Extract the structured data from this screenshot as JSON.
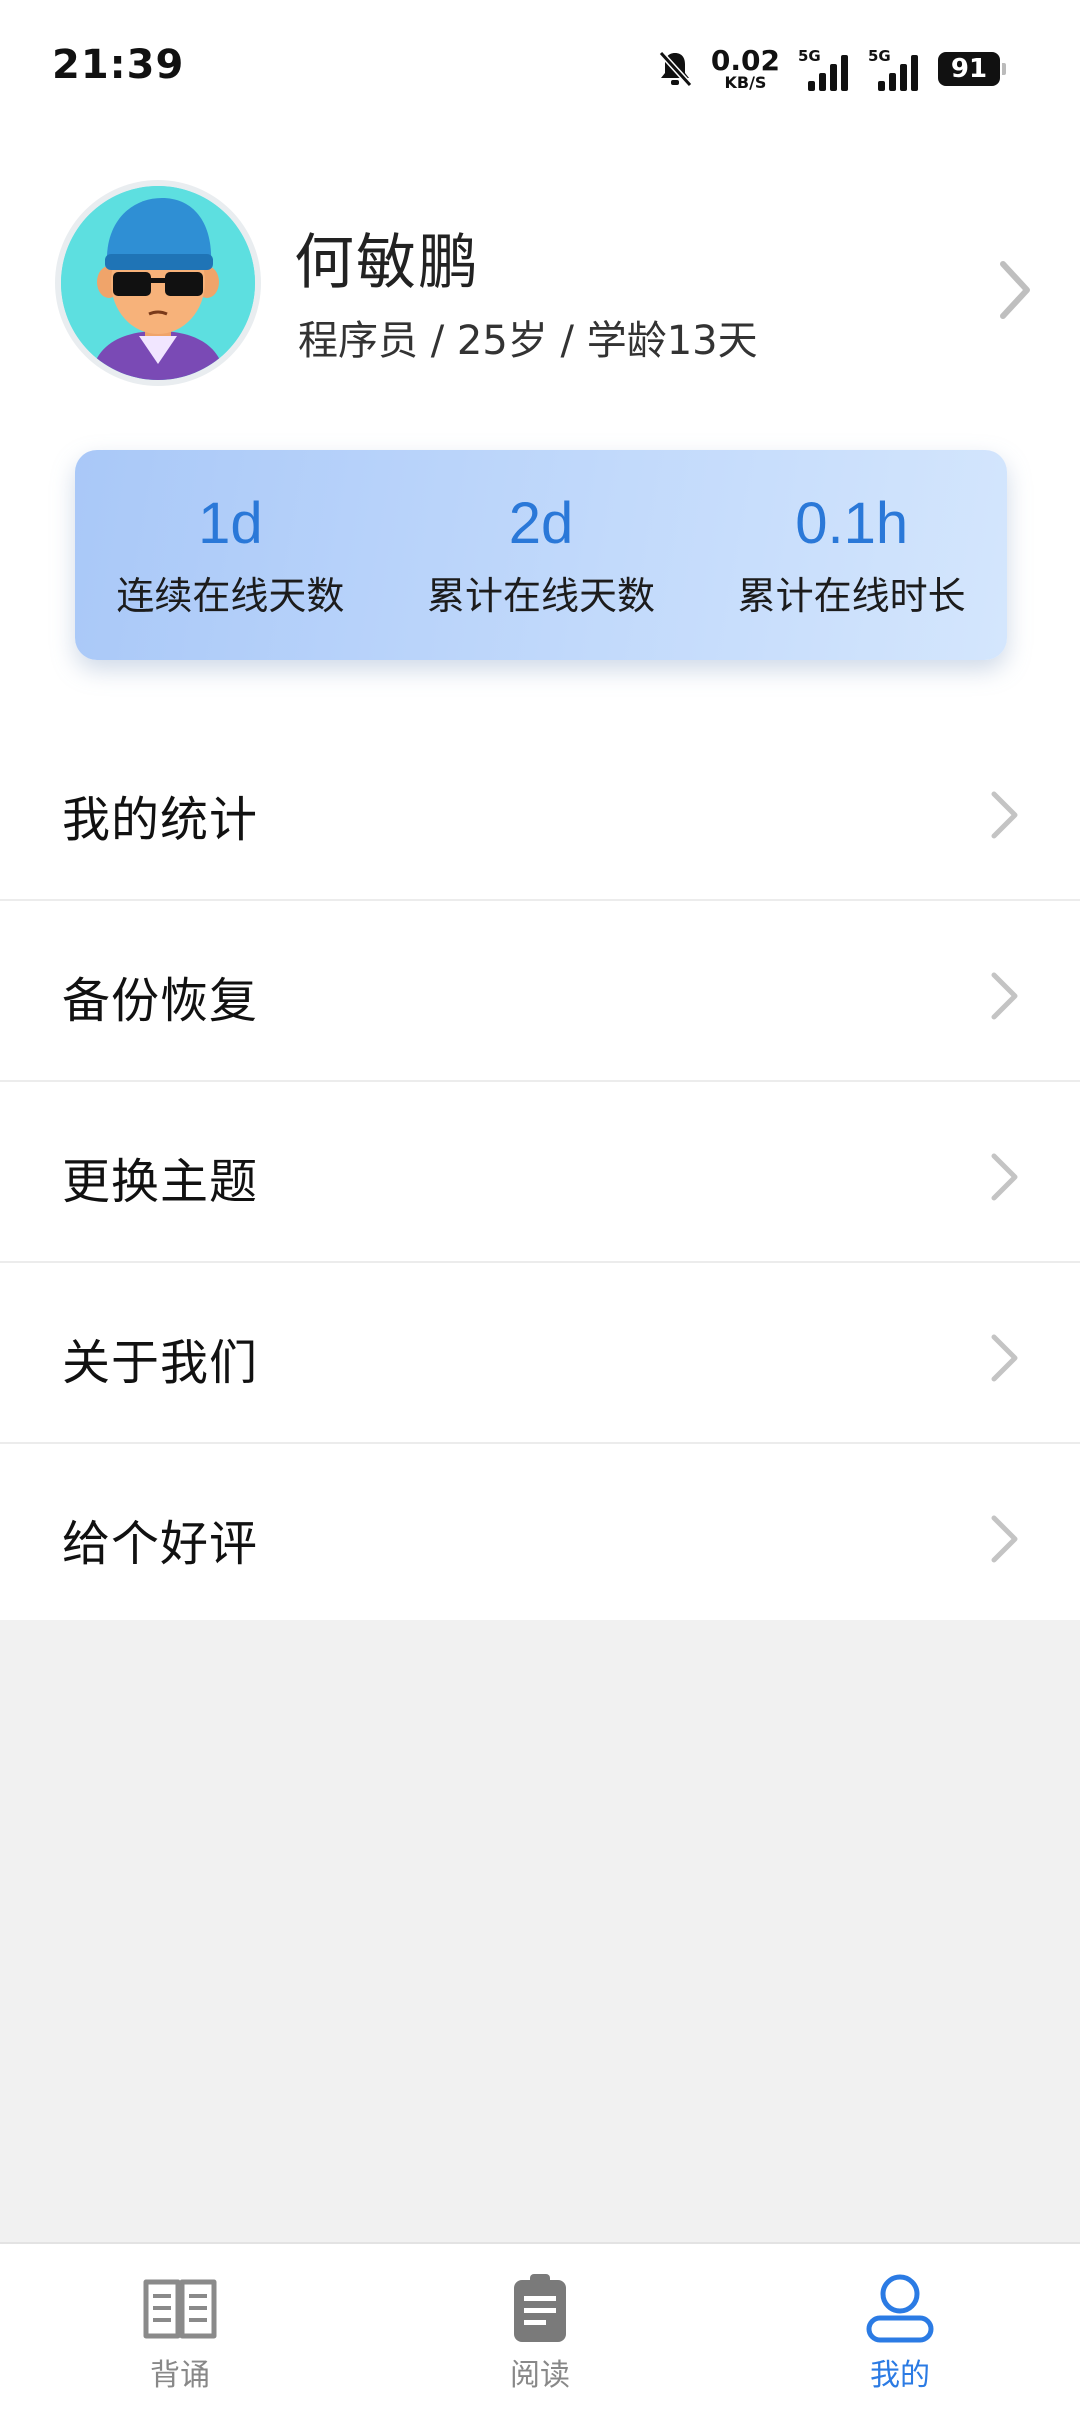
{
  "status_bar": {
    "time": "21:39",
    "net_speed_value": "0.02",
    "net_speed_unit": "KB/S",
    "signal1_label": "5G",
    "signal2_label": "5G",
    "battery": "91"
  },
  "profile": {
    "name": "何敏鹏",
    "subtitle": "程序员 / 25岁 / 学龄13天"
  },
  "stats": [
    {
      "value": "1d",
      "label": "连续在线天数"
    },
    {
      "value": "2d",
      "label": "累计在线天数"
    },
    {
      "value": "0.1h",
      "label": "累计在线时长"
    }
  ],
  "menu": [
    {
      "label": "我的统计"
    },
    {
      "label": "备份恢复"
    },
    {
      "label": "更换主题"
    },
    {
      "label": "关于我们"
    },
    {
      "label": "给个好评"
    }
  ],
  "nav": [
    {
      "label": "背诵",
      "icon": "book-icon"
    },
    {
      "label": "阅读",
      "icon": "clipboard-icon"
    },
    {
      "label": "我的",
      "icon": "person-icon"
    }
  ],
  "colors": {
    "accent": "#2b7be4",
    "stat_value": "#2a78d8",
    "nav_inactive": "#888888",
    "card_gradient_start": "#a9c8f8",
    "card_gradient_end": "#d4e6fd"
  }
}
